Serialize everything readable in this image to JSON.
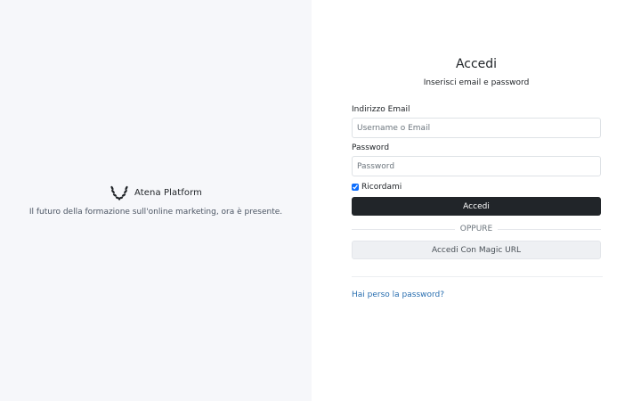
{
  "brand": {
    "name": "Atena Platform",
    "tagline": "Il futuro della formazione sull'online marketing, ora è presente.",
    "logo_icon": "laurel-wreath-icon"
  },
  "login": {
    "title": "Accedi",
    "subtitle": "Inserisci email e password",
    "email": {
      "label": "Indirizzo Email",
      "placeholder": "Username o Email",
      "value": ""
    },
    "password": {
      "label": "Password",
      "placeholder": "Password",
      "value": ""
    },
    "remember": {
      "label": "Ricordami",
      "checked": true
    },
    "submit_label": "Accedi",
    "divider_text": "OPPURE",
    "magic_url_label": "Accedi Con Magic URL",
    "forgot_label": "Hai perso la password?"
  },
  "colors": {
    "left_bg": "#f6f7fa",
    "primary_button": "#212529",
    "link": "#2a6fb0"
  }
}
